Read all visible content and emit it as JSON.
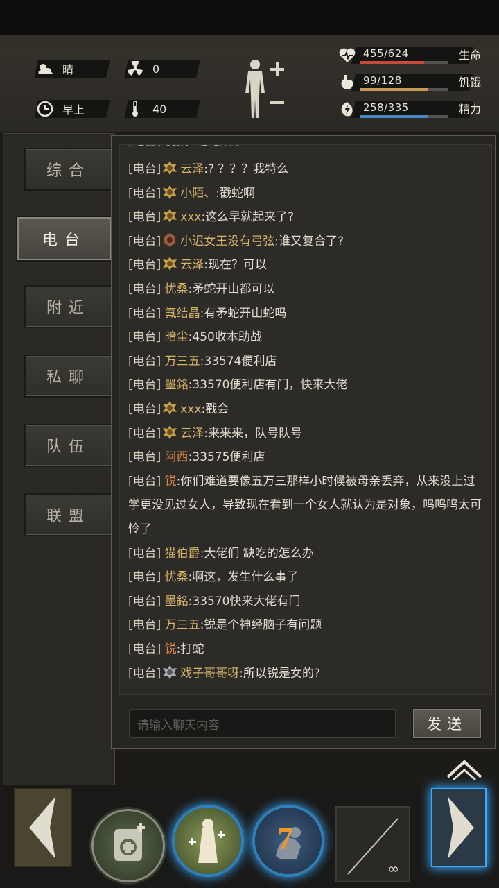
{
  "status": {
    "weather": "晴",
    "radiation": "0",
    "time_of_day": "早上",
    "temperature": "40"
  },
  "vitals": [
    {
      "value": "455/624",
      "label": "生命",
      "fraction": 0.729,
      "color": "#c94a3c",
      "icon": "heart-icon"
    },
    {
      "value": "99/128",
      "label": "饥饿",
      "fraction": 0.773,
      "color": "#c99b5a",
      "icon": "stomach-icon"
    },
    {
      "value": "258/335",
      "label": "精力",
      "fraction": 0.77,
      "color": "#4a86c4",
      "icon": "energy-icon"
    }
  ],
  "tabs": [
    "综合",
    "电台",
    "附近",
    "私聊",
    "队伍",
    "联盟"
  ],
  "active_tab": "电台",
  "chat": {
    "partial_top": "[电台] 忧桑 :蛇蛇来吊",
    "channel_label": "[电台]",
    "messages": [
      {
        "name": "云泽",
        "text": ":? ？？？我特么",
        "badge": "gold"
      },
      {
        "name": "小陌、",
        "text": ":戳蛇啊",
        "badge": "gold"
      },
      {
        "name": "xxx",
        "text": ":这么早就起来了?",
        "badge": "gold"
      },
      {
        "name": "小迟女王没有弓弦",
        "text": ":谁又复合了?",
        "badge": "bronze"
      },
      {
        "name": "云泽",
        "text": ":现在？可以",
        "badge": "gold"
      },
      {
        "name": "忧桑",
        "text": ":矛蛇开山都可以",
        "badge": ""
      },
      {
        "name": "氟结晶",
        "text": ":有矛蛇开山蛇吗",
        "badge": ""
      },
      {
        "name": "暗尘",
        "text": ":450收本助战",
        "badge": ""
      },
      {
        "name": "万三五",
        "text": ":33574便利店",
        "badge": ""
      },
      {
        "name": "墨銘",
        "text": ":33570便利店有门，快来大佬",
        "badge": ""
      },
      {
        "name": "xxx",
        "text": ":戳会",
        "badge": "gold"
      },
      {
        "name": "云泽",
        "text": ":来来来，队号队号",
        "badge": "gold"
      },
      {
        "name": "阿西",
        "text": ":33575便利店",
        "badge": "",
        "name_color": "orange"
      },
      {
        "name": "锐",
        "text": ":你们难道要像五万三那样小时候被母亲丢弃，从来没上过学更没见过女人，导致现在看到一个女人就认为是对象，呜呜呜太可怜了",
        "badge": "",
        "name_color": "orange"
      },
      {
        "name": "猫伯爵",
        "text": ":大佬们 缺吃的怎么办",
        "badge": ""
      },
      {
        "name": "忧桑",
        "text": ":啊这，发生什么事了",
        "badge": ""
      },
      {
        "name": "墨銘",
        "text": ":33570快来大佬有门",
        "badge": ""
      },
      {
        "name": "万三五",
        "text": ":锐是个神经脑子有问题",
        "badge": ""
      },
      {
        "name": "锐",
        "text": ":打蛇",
        "badge": "",
        "name_color": "orange"
      },
      {
        "name": "戏子哥哥呀",
        "text": ":所以锐是女的?",
        "badge": "silver"
      }
    ],
    "input_placeholder": "请输入聊天内容",
    "send_label": "发送"
  },
  "hotbar": {
    "item_count": "7",
    "weapon_durability": "∞"
  }
}
